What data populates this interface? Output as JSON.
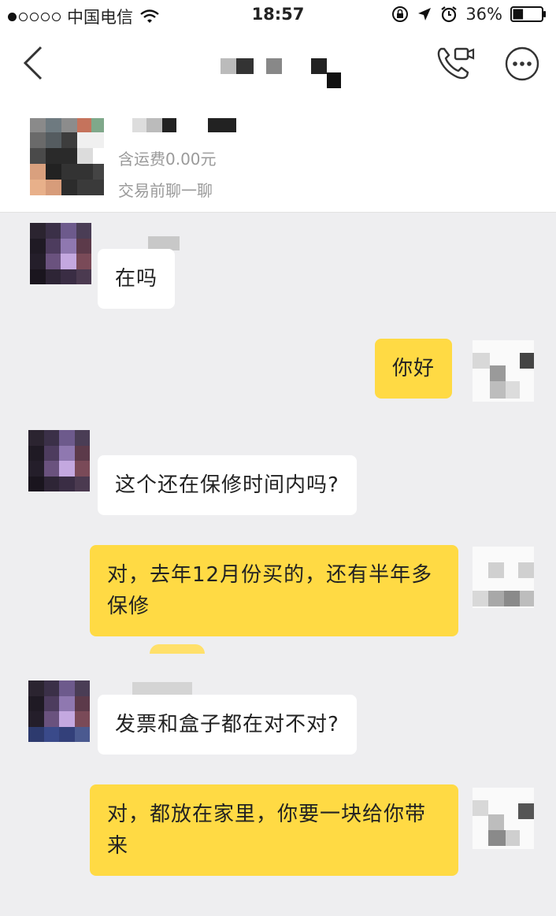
{
  "status_bar": {
    "carrier": "中国电信",
    "time": "18:57",
    "battery_percent": "36%",
    "battery_level": 0.36
  },
  "product": {
    "shipping": "含运费0.00元",
    "hint": "交易前聊一聊"
  },
  "messages": [
    {
      "from": "other",
      "text": "在吗"
    },
    {
      "from": "me",
      "text": "你好"
    },
    {
      "from": "other",
      "text": "这个还在保修时间内吗?"
    },
    {
      "from": "me",
      "text": "对，去年12月份买的，还有半年多保修"
    },
    {
      "from": "other",
      "text": "发票和盒子都在对不对?"
    },
    {
      "from": "me",
      "text": "对，都放在家里，你要一块给你带来"
    }
  ],
  "colors": {
    "outgoing_bubble": "#ffda44",
    "incoming_bubble": "#ffffff",
    "background": "#eeeef0"
  },
  "icons": {
    "back": "chevron-left-icon",
    "video_call": "video-call-icon",
    "more": "more-icon",
    "wifi": "wifi-icon",
    "battery": "battery-icon"
  }
}
